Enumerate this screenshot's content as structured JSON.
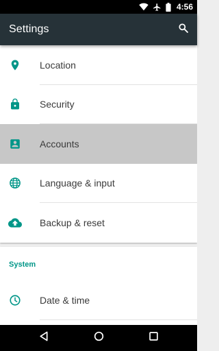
{
  "status_bar": {
    "time": "4:56",
    "icons": [
      "wifi-icon",
      "airplane-icon",
      "battery-icon"
    ]
  },
  "app_bar": {
    "title": "Settings",
    "search_icon": "search-icon"
  },
  "settings_items": [
    {
      "label": "Location",
      "icon": "location-pin-icon",
      "selected": false
    },
    {
      "label": "Security",
      "icon": "lock-icon",
      "selected": false
    },
    {
      "label": "Accounts",
      "icon": "account-box-icon",
      "selected": true
    },
    {
      "label": "Language & input",
      "icon": "globe-icon",
      "selected": false
    },
    {
      "label": "Backup & reset",
      "icon": "cloud-upload-icon",
      "selected": false
    }
  ],
  "system_section": {
    "title": "System",
    "items": [
      {
        "label": "Date & time",
        "icon": "clock-icon"
      }
    ]
  },
  "nav_bar": {
    "buttons": [
      "back-icon",
      "home-icon",
      "recents-icon"
    ]
  },
  "colors": {
    "accent": "#009688",
    "app_bar": "#263238",
    "selected_row": "#c7c7c7",
    "background": "#eeeeee"
  }
}
